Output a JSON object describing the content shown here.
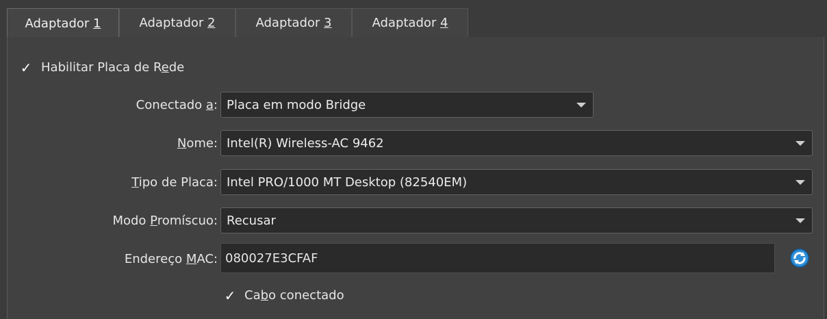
{
  "tabs": [
    {
      "prefix": "Adaptador ",
      "key": "1"
    },
    {
      "prefix": "Adaptador ",
      "key": "2"
    },
    {
      "prefix": "Adaptador ",
      "key": "3"
    },
    {
      "prefix": "Adaptador ",
      "key": "4"
    }
  ],
  "enable": {
    "checked_glyph": "✓",
    "label_a": "Habilitar Placa de R",
    "label_u": "e",
    "label_b": "de"
  },
  "attached": {
    "label_a": "Conectado ",
    "label_u": "a",
    "label_b": ":",
    "value": "Placa em modo Bridge"
  },
  "name": {
    "label_u": "N",
    "label_b": "ome:",
    "value": "Intel(R) Wireless-AC 9462"
  },
  "adapter_type": {
    "label_u": "T",
    "label_b": "ipo de Placa:",
    "value": "Intel PRO/1000 MT Desktop (82540EM)"
  },
  "promiscuous": {
    "label_a": "Modo ",
    "label_u": "P",
    "label_b": "romíscuo:",
    "value": "Recusar"
  },
  "mac": {
    "label_a": "Endereço ",
    "label_u": "M",
    "label_b": "AC:",
    "value": "080027E3CFAF"
  },
  "cable": {
    "checked_glyph": "✓",
    "label_a": "Ca",
    "label_u": "b",
    "label_b": "o conectado"
  },
  "colors": {
    "refresh_icon": "#2f8fd8"
  }
}
